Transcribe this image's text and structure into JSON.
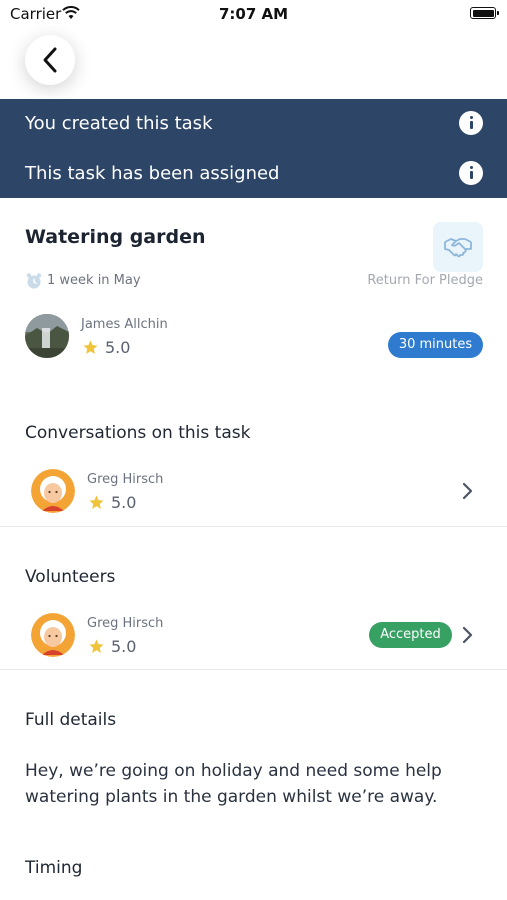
{
  "status_bar": {
    "carrier": "Carrier",
    "time": "7:07 AM"
  },
  "banner": {
    "created_text": "You created this task",
    "assigned_text": "This task has been assigned",
    "background_color": "#2d4566"
  },
  "task": {
    "title": "Watering garden",
    "when": "1 week in May",
    "pledge_label": "Return For Pledge",
    "owner": {
      "name": "James Allchin",
      "rating": "5.0"
    },
    "duration": "30 minutes"
  },
  "conversations": {
    "title": "Conversations on this task",
    "items": [
      {
        "name": "Greg Hirsch",
        "rating": "5.0"
      }
    ]
  },
  "volunteers": {
    "title": "Volunteers",
    "items": [
      {
        "name": "Greg Hirsch",
        "rating": "5.0",
        "status": "Accepted"
      }
    ]
  },
  "details": {
    "title": "Full details",
    "text": "Hey, we’re going on holiday and need some help watering plants in the garden whilst we’re away."
  },
  "timing": {
    "title": "Timing"
  },
  "colors": {
    "accent_blue": "#2e7bcf",
    "accepted_green": "#37a063",
    "star": "#f0c43a"
  }
}
